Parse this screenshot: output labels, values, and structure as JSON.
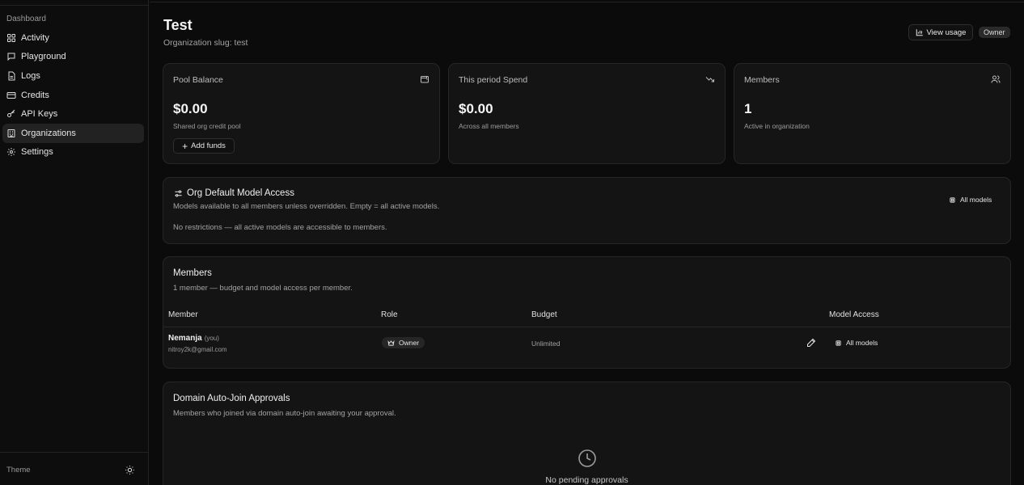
{
  "sidebar": {
    "section_label": "Dashboard",
    "items": [
      {
        "label": "Activity",
        "icon": "grid-icon"
      },
      {
        "label": "Playground",
        "icon": "chat-icon"
      },
      {
        "label": "Logs",
        "icon": "file-icon"
      },
      {
        "label": "Credits",
        "icon": "card-icon"
      },
      {
        "label": "API Keys",
        "icon": "key-icon"
      },
      {
        "label": "Organizations",
        "icon": "building-icon",
        "active": true
      },
      {
        "label": "Settings",
        "icon": "gear-icon"
      }
    ],
    "theme_label": "Theme"
  },
  "header": {
    "title": "Test",
    "slug": "Organization slug: test",
    "view_usage_label": "View usage",
    "role_badge": "Owner"
  },
  "stats": [
    {
      "title": "Pool Balance",
      "value": "$0.00",
      "sub": "Shared org credit pool",
      "icon": "wallet-icon",
      "button": "Add funds"
    },
    {
      "title": "This period Spend",
      "value": "$0.00",
      "sub": "Across all members",
      "icon": "trending-down-icon"
    },
    {
      "title": "Members",
      "value": "1",
      "sub": "Active in organization",
      "icon": "users-icon"
    }
  ],
  "model_access": {
    "title": "Org Default Model Access",
    "description": "Models available to all members unless overridden. Empty = all active models.",
    "status": "No restrictions — all active models are accessible to members.",
    "tag": "All models"
  },
  "members": {
    "title": "Members",
    "description": "1 member — budget and model access per member.",
    "columns": [
      "Member",
      "Role",
      "Budget",
      "Model Access"
    ],
    "rows": [
      {
        "name": "Nemanja",
        "you": "(you)",
        "email": "nitroy2k@gmail.com",
        "role": "Owner",
        "budget": "Unlimited",
        "model_access": "All models"
      }
    ]
  },
  "approvals": {
    "title": "Domain Auto-Join Approvals",
    "description": "Members who joined via domain auto-join awaiting your approval.",
    "empty_text": "No pending approvals"
  }
}
